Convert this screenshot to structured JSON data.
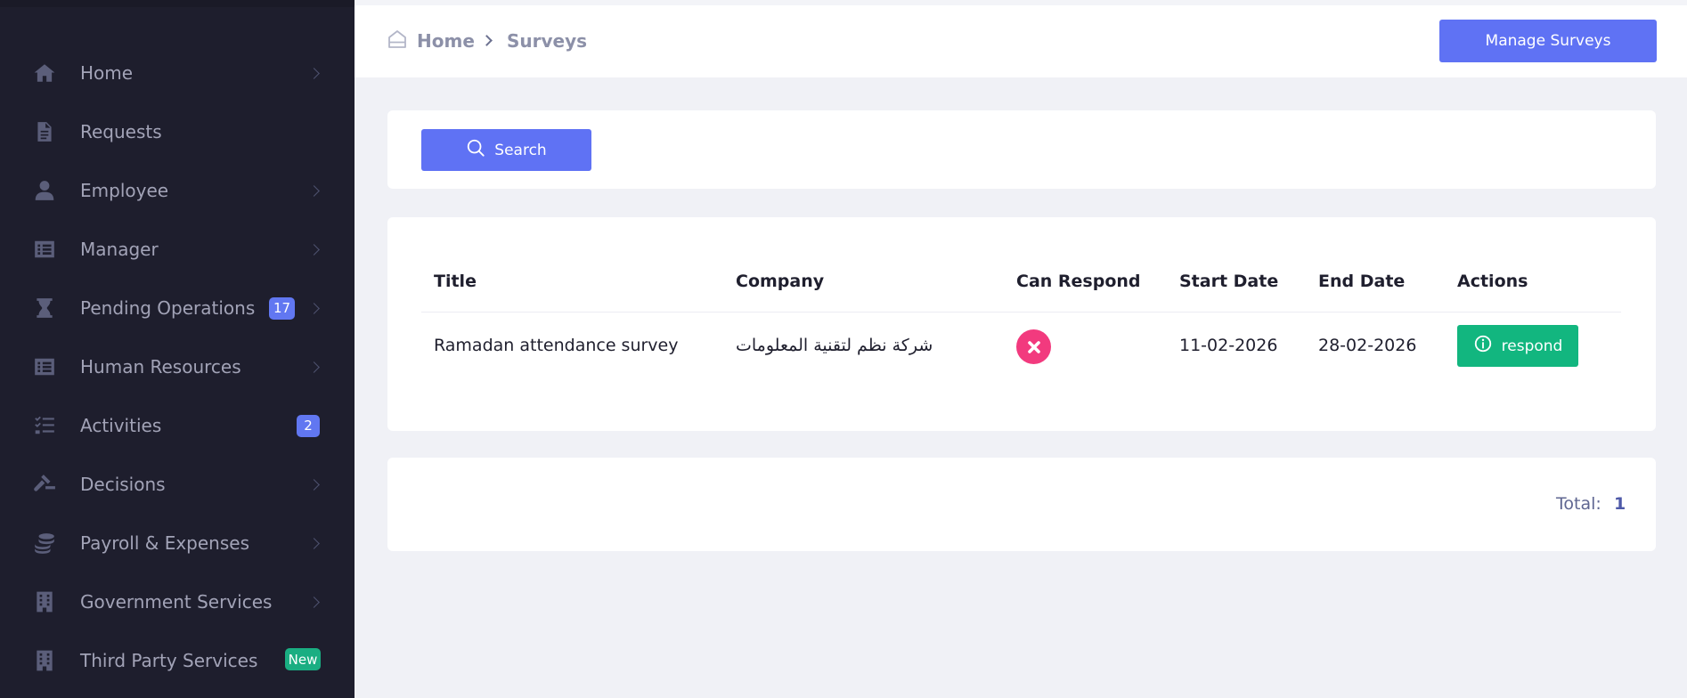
{
  "sidebar": {
    "items": [
      {
        "label": "Home",
        "icon": "home-icon",
        "chevron": true
      },
      {
        "label": "Requests",
        "icon": "document-icon",
        "chevron": false
      },
      {
        "label": "Employee",
        "icon": "user-icon",
        "chevron": true
      },
      {
        "label": "Manager",
        "icon": "list-icon",
        "chevron": true
      },
      {
        "label": "Pending Operations",
        "icon": "hourglass-icon",
        "chevron": true,
        "badge": "17"
      },
      {
        "label": "Human Resources",
        "icon": "list-icon",
        "chevron": true
      },
      {
        "label": "Activities",
        "icon": "checklist-icon",
        "chevron": false,
        "badge": "2"
      },
      {
        "label": "Decisions",
        "icon": "gavel-icon",
        "chevron": true
      },
      {
        "label": "Payroll & Expenses",
        "icon": "coins-icon",
        "chevron": true
      },
      {
        "label": "Government Services",
        "icon": "building-icon",
        "chevron": true
      },
      {
        "label": "Third Party Services",
        "icon": "building-icon",
        "chevron": false,
        "badge": "New"
      }
    ]
  },
  "header": {
    "breadcrumb": {
      "home": "Home",
      "current": "Surveys"
    },
    "manage_button": "Manage Surveys"
  },
  "search": {
    "button_label": "Search"
  },
  "table": {
    "columns": {
      "title": "Title",
      "company": "Company",
      "can_respond": "Can Respond",
      "start_date": "Start Date",
      "end_date": "End Date",
      "actions": "Actions"
    },
    "rows": [
      {
        "title": "Ramadan attendance survey",
        "company": "شركة نظم لتقنية المعلومات",
        "can_respond": false,
        "start_date": "11-02-2026",
        "end_date": "28-02-2026",
        "action_label": "respond"
      }
    ]
  },
  "footer": {
    "total_label": "Total:",
    "total_value": "1"
  },
  "colors": {
    "sidebar_bg": "#1e1e2d",
    "primary": "#5f72f4",
    "success": "#12b67f",
    "danger": "#f23a7e",
    "page_bg": "#f0f1f6"
  }
}
